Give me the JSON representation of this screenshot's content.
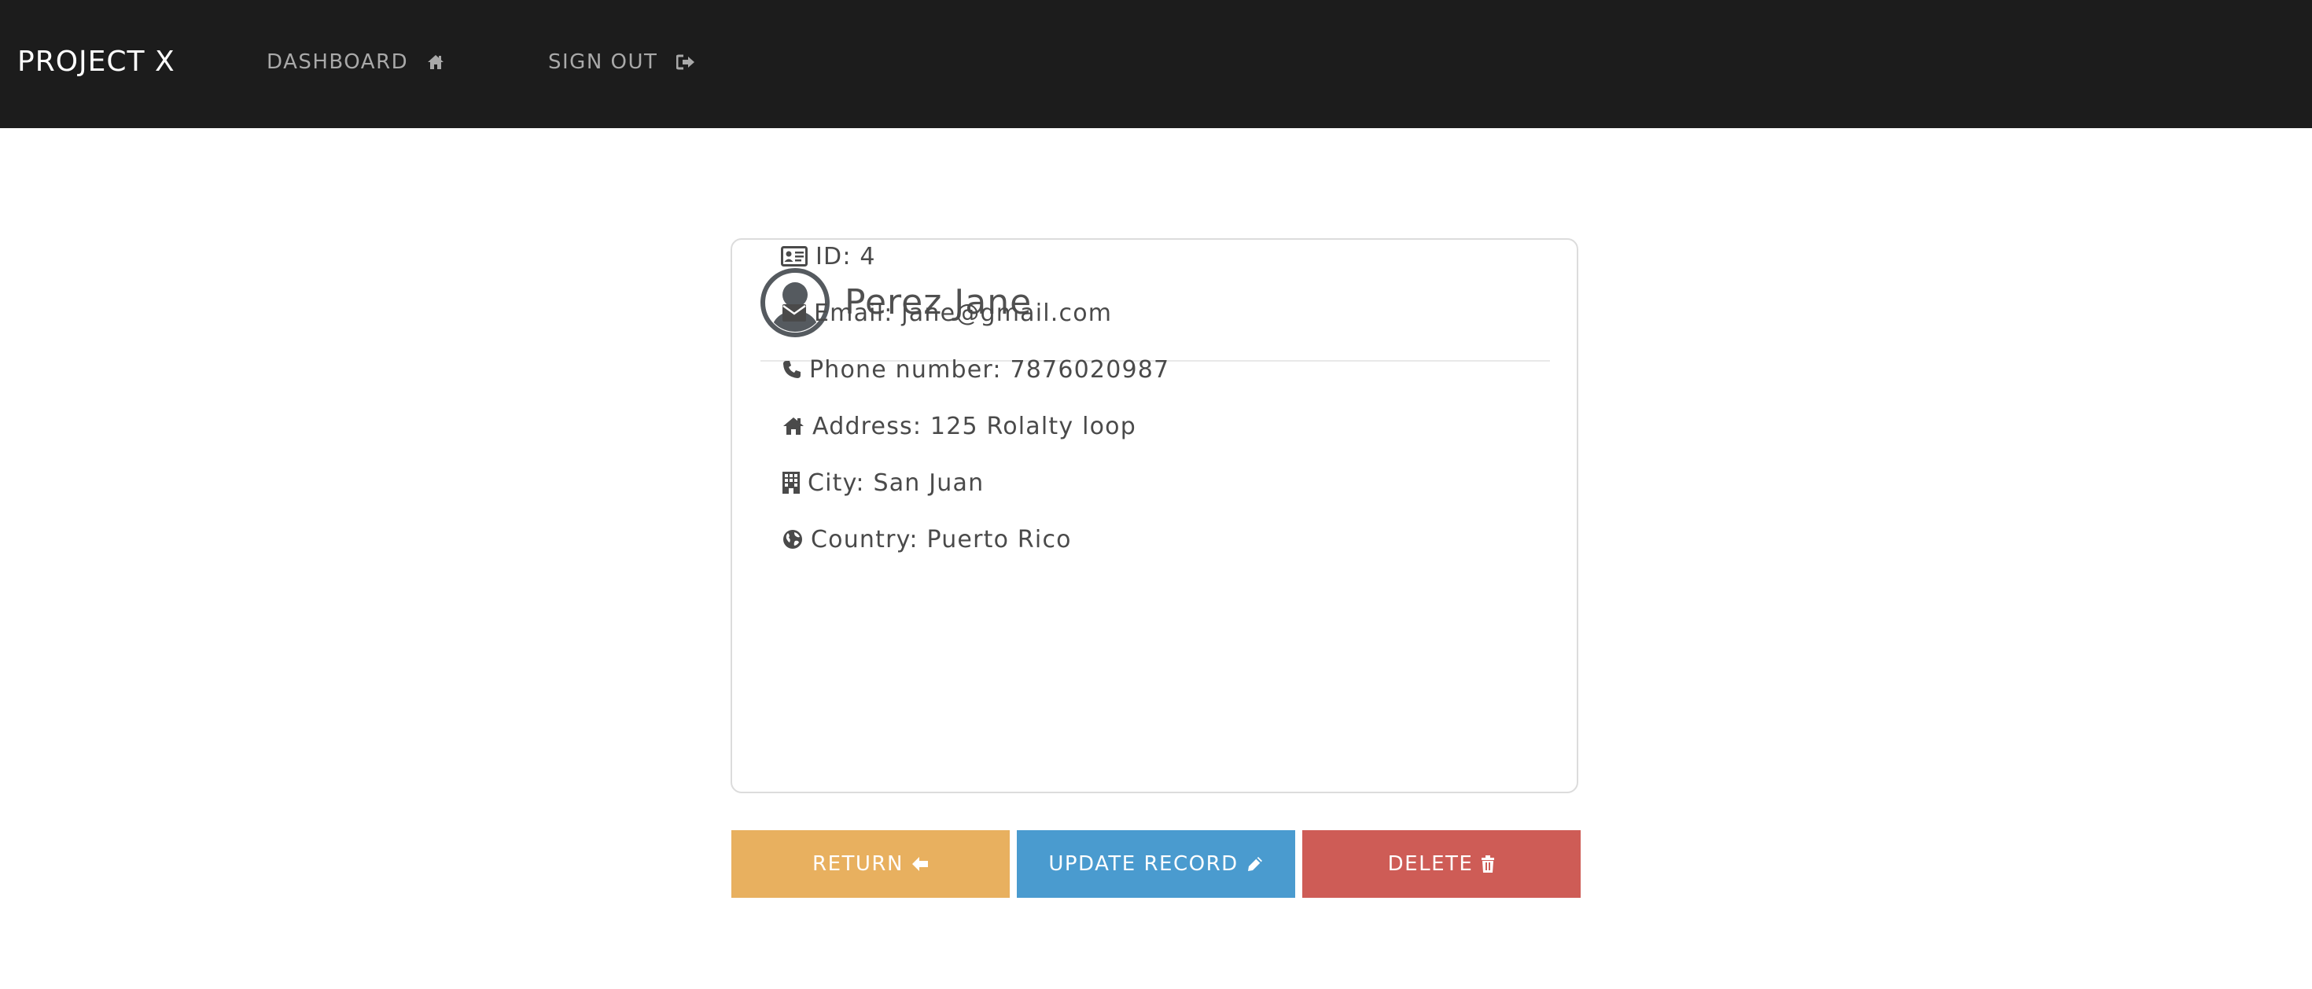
{
  "navbar": {
    "brand": "PROJECT X",
    "links": [
      {
        "label": "DASHBOARD",
        "icon": "home-icon"
      },
      {
        "label": "SIGN OUT",
        "icon": "sign-out-icon"
      }
    ],
    "background": "#1c1c1c"
  },
  "profile": {
    "name": "Perez Jane",
    "avatar_icon": "user-circle-icon",
    "fields": {
      "id": "ID: 4",
      "email": "Email: jane@gmail.com",
      "phone": "Phone number: 7876020987",
      "address": "Address: 125 Rolalty loop",
      "city": "City: San Juan",
      "country": "Country: Puerto Rico"
    },
    "field_icons": {
      "id": "id-card-icon",
      "email": "envelope-icon",
      "phone": "phone-icon",
      "address": "home-icon",
      "city": "building-icon",
      "country": "globe-icon"
    }
  },
  "actions": {
    "return_label": "RETURN",
    "update_label": "UPDATE RECORD",
    "delete_label": "DELETE",
    "colors": {
      "return": "#e8b05f",
      "update": "#4a9bcf",
      "delete": "#ce5c56"
    }
  }
}
